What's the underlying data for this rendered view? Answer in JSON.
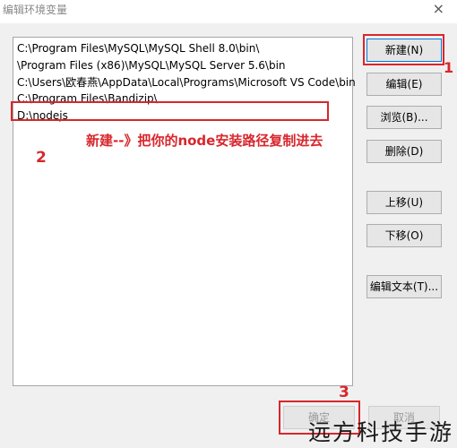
{
  "window": {
    "title": "编辑环境变量",
    "close_glyph": "×"
  },
  "paths": [
    "C:\\Program Files\\MySQL\\MySQL Shell 8.0\\bin\\",
    "\\Program Files (x86)\\MySQL\\MySQL Server 5.6\\bin",
    "C:\\Users\\欧春燕\\AppData\\Local\\Programs\\Microsoft VS Code\\bin",
    "C:\\Program Files\\Bandizip\\",
    "D:\\nodejs"
  ],
  "buttons": {
    "new": "新建(N)",
    "edit": "编辑(E)",
    "browse": "浏览(B)...",
    "delete": "删除(D)",
    "move_up": "上移(U)",
    "move_down": "下移(O)",
    "edit_text": "编辑文本(T)...",
    "ok": "确定",
    "cancel": "取消"
  },
  "annotations": {
    "step1": "1",
    "step2": "2",
    "step3": "3",
    "instruction": "新建--》把你的node安装路径复制进去",
    "color": "#d9262c"
  },
  "watermark": "远方科技手游"
}
